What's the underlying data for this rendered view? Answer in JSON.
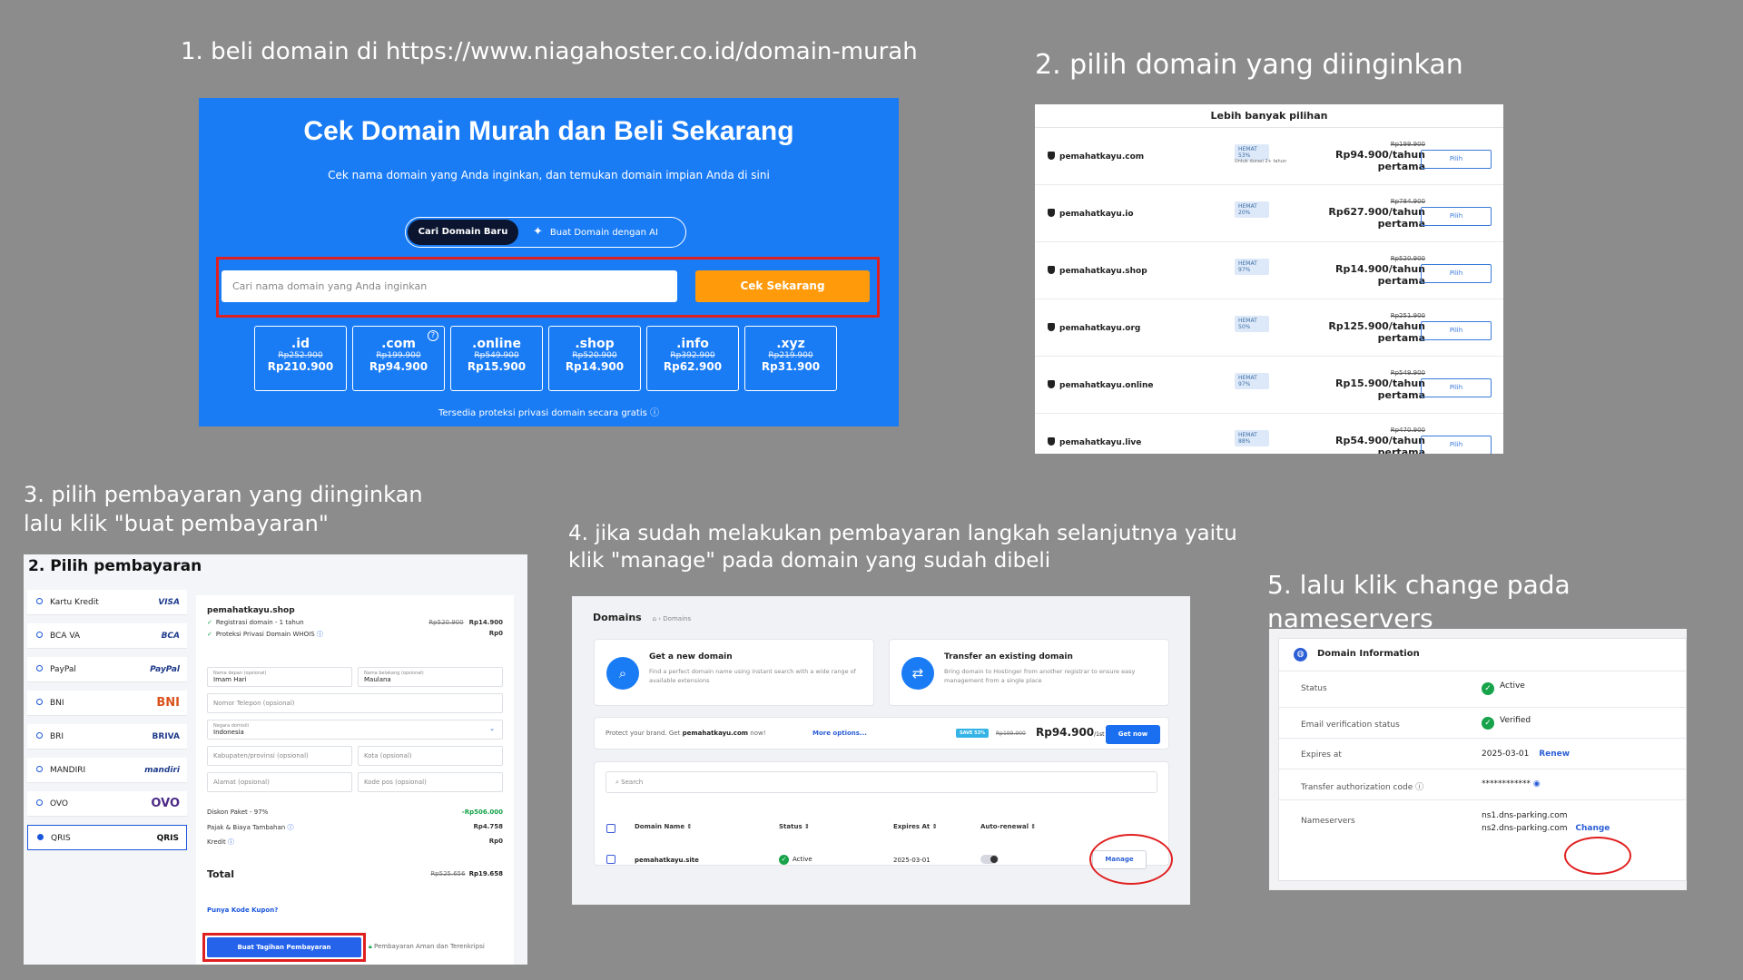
{
  "steps": {
    "s1": "1. beli domain di https://www.niagahoster.co.id/domain-murah",
    "s2": "2. pilih domain yang diinginkan",
    "s3": "3. pilih pembayaran yang diinginkan\n lalu klik \"buat pembayaran\"",
    "s4": "4. jika sudah melakukan pembayaran langkah selanjutnya yaitu\n    klik \"manage\" pada domain yang sudah dibeli",
    "s5": "5. lalu klik change pada nameservers"
  },
  "p1": {
    "title": "Cek Domain Murah dan Beli Sekarang",
    "subtitle": "Cek nama domain yang Anda inginkan, dan temukan domain impian Anda di sini",
    "tab_active": "Cari Domain Baru",
    "tab_ai": "Buat Domain dengan AI",
    "search_placeholder": "Cari nama domain yang Anda inginkan",
    "cek_button": "Cek Sekarang",
    "tlds": [
      {
        "name": ".id",
        "old": "Rp252.900",
        "price": "Rp210.900"
      },
      {
        "name": ".com",
        "old": "Rp199.900",
        "price": "Rp94.900"
      },
      {
        "name": ".online",
        "old": "Rp549.900",
        "price": "Rp15.900"
      },
      {
        "name": ".shop",
        "old": "Rp520.900",
        "price": "Rp14.900"
      },
      {
        "name": ".info",
        "old": "Rp392.900",
        "price": "Rp62.900"
      },
      {
        "name": ".xyz",
        "old": "Rp219.900",
        "price": "Rp31.900"
      }
    ],
    "footer": "Tersedia proteksi privasi domain secara gratis"
  },
  "p2": {
    "header": "Lebih banyak pilihan",
    "rows": [
      {
        "domain": "pemahatkayu.com",
        "badge": "HEMAT 53%",
        "note": "Untuk durasi 2+ tahun",
        "old": "Rp199.900",
        "price": "Rp94.900/tahun pertama",
        "btn": "Pilih"
      },
      {
        "domain": "pemahatkayu.io",
        "badge": "HEMAT 20%",
        "note": "",
        "old": "Rp784.900",
        "price": "Rp627.900/tahun pertama",
        "btn": "Pilih"
      },
      {
        "domain": "pemahatkayu.shop",
        "badge": "HEMAT 97%",
        "note": "",
        "old": "Rp520.900",
        "price": "Rp14.900/tahun pertama",
        "btn": "Pilih"
      },
      {
        "domain": "pemahatkayu.org",
        "badge": "HEMAT 50%",
        "note": "",
        "old": "Rp251.900",
        "price": "Rp125.900/tahun pertama",
        "btn": "Pilih"
      },
      {
        "domain": "pemahatkayu.online",
        "badge": "HEMAT 97%",
        "note": "",
        "old": "Rp549.900",
        "price": "Rp15.900/tahun pertama",
        "btn": "Pilih"
      },
      {
        "domain": "pemahatkayu.live",
        "badge": "HEMAT 88%",
        "note": "",
        "old": "Rp470.900",
        "price": "Rp54.900/tahun pertama",
        "btn": "Pilih"
      }
    ]
  },
  "p3": {
    "title": "2. Pilih pembayaran",
    "methods": [
      {
        "name": "Kartu Kredit",
        "logo": "VISA"
      },
      {
        "name": "BCA VA",
        "logo": "BCA"
      },
      {
        "name": "PayPal",
        "logo": "PayPal"
      },
      {
        "name": "BNI",
        "logo": "BNI"
      },
      {
        "name": "BRI",
        "logo": "BRIVA"
      },
      {
        "name": "MANDIRI",
        "logo": "mandiri"
      },
      {
        "name": "OVO",
        "logo": "OVO"
      },
      {
        "name": "QRIS",
        "logo": "QRIS"
      }
    ],
    "domain": "pemahatkayu.shop",
    "line1": "Registrasi domain - 1 tahun",
    "line1_old": "Rp520.900",
    "line1_price": "Rp14.900",
    "line2": "Proteksi Privasi Domain WHOIS",
    "line2_price": "Rp0",
    "first_name_label": "Nama depan (opsional)",
    "first_name": "Imam Hari",
    "last_name_label": "Nama belakang (opsional)",
    "last_name": "Maulana",
    "phone": "Nomor Telepon (opsional)",
    "country_label": "Negara domisili",
    "country": "Indonesia",
    "city_prov": "Kabupaten/provinsi (opsional)",
    "city": "Kota (opsional)",
    "address": "Alamat (opsional)",
    "postcode": "Kode pos (opsional)",
    "discount_label": "Diskon Paket - 97%",
    "discount": "-Rp506.000",
    "tax_label": "Pajak & Biaya Tambahan",
    "tax": "Rp4.758",
    "credit_label": "Kredit",
    "credit": "Rp0",
    "total_label": "Total",
    "total_old": "Rp525.656",
    "total": "Rp19.658",
    "coupon": "Punya Kode Kupon?",
    "pay_button": "Buat Tagihan Pembayaran",
    "secure": "Pembayaran Aman dan Terenkripsi"
  },
  "p4": {
    "title": "Domains",
    "crumb": "Domains",
    "card1_title": "Get a new domain",
    "card1_desc": "Find a perfect domain name using instant search with a wide range of available extensions",
    "card2_title": "Transfer an existing domain",
    "card2_desc": "Bring domain to Hostinger from another registrar to ensure easy management from a single place",
    "protect": "Protect your brand. Get",
    "protect_domain": "pemahatkayu.com",
    "protect_now": "now!",
    "more": "More options...",
    "save": "SAVE 53%",
    "old": "Rp199.900",
    "price": "Rp94.900",
    "per": "/1st yr",
    "get_now": "Get now",
    "search": "Search",
    "col_name": "Domain Name",
    "col_status": "Status",
    "col_exp": "Expires At",
    "col_auto": "Auto-renewal",
    "row_domain": "pemahatkayu.site",
    "row_status": "Active",
    "row_exp": "2025-03-01",
    "manage": "Manage"
  },
  "p5": {
    "title": "Domain Information",
    "status_k": "Status",
    "status_v": "Active",
    "email_k": "Email verification status",
    "email_v": "Verified",
    "exp_k": "Expires at",
    "exp_v": "2025-03-01",
    "renew": "Renew",
    "auth_k": "Transfer authorization code",
    "auth_v": "************",
    "ns_k": "Nameservers",
    "ns1": "ns1.dns-parking.com",
    "ns2": "ns2.dns-parking.com",
    "change": "Change"
  }
}
